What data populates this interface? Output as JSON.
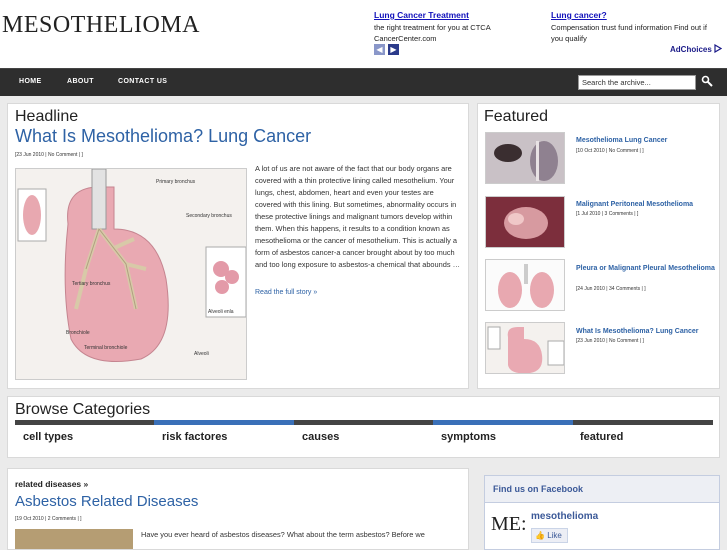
{
  "site": {
    "logo": "MESOTHELIOMA"
  },
  "ads": [
    {
      "title": "Lung Cancer Treatment",
      "text": "the right treatment for you at CTCA CancerCenter.com"
    },
    {
      "title": "Lung cancer?",
      "text": "Compensation trust fund information Find out if you qualify"
    }
  ],
  "adchoices": "AdChoices",
  "nav": {
    "items": [
      "HOME",
      "ABOUT",
      "CONTACT US"
    ]
  },
  "search": {
    "placeholder": "Search the archive..."
  },
  "headline": {
    "section": "Headline",
    "title": "What Is Mesothelioma? Lung Cancer",
    "meta": "[23 Jun 2010 | No Comment | ]",
    "excerpt": "A lot of us are not aware of the fact that our body organs are covered with a thin protective lining called mesothelium. Your lungs, chest, abdomen, heart and even your testes are covered with this lining. But sometimes, abnormality occurs in these protective linings and malignant tumors develop within them. When this happens, it results to a condition known as mesothelioma or the cancer of mesothelium. This is actually a form of asbestos cancer-a cancer brought about by too much and too long exposure to asbestos-a chemical that abounds …",
    "read_more": "Read the full story »",
    "image_labels": [
      "Primary bronchus",
      "Secondary bronchus",
      "Tertiary bronchus",
      "Bronchiole",
      "Terminal bronchiole",
      "Alveoli",
      "Alveoli enla"
    ]
  },
  "featured": {
    "section": "Featured",
    "items": [
      {
        "title": "Mesothelioma Lung Cancer",
        "meta": "[10 Oct 2010 | No Comment | ]"
      },
      {
        "title": "Malignant Peritoneal Mesothelioma",
        "meta": "[1 Jul 2010 | 3 Comments | ]"
      },
      {
        "title": "Pleura or Malignant Pleural Mesothelioma",
        "meta": "[24 Jun 2010 | 34 Comments | ]"
      },
      {
        "title": "What Is Mesothelioma? Lung Cancer",
        "meta": "[23 Jun 2010 | No Comment | ]"
      }
    ]
  },
  "categories": {
    "section": "Browse Categories",
    "items": [
      "cell types",
      "risk factores",
      "causes",
      "symptoms",
      "featured"
    ]
  },
  "related": {
    "heading": "related diseases »",
    "title": "Asbestos Related Diseases",
    "meta": "[19 Oct 2010 | 2 Comments | ]",
    "text": "Have you ever heard of asbestos diseases? What about the term asbestos? Before we"
  },
  "facebook": {
    "title": "Find us on Facebook",
    "logo": "ME:",
    "name": "mesothelioma",
    "like": "Like"
  },
  "colors": {
    "accent": "#2e62a5",
    "nav_bg": "#2e2e2e",
    "category_blue": "#3a70b8",
    "category_grey": "#444444",
    "facebook": "#3b5998"
  }
}
